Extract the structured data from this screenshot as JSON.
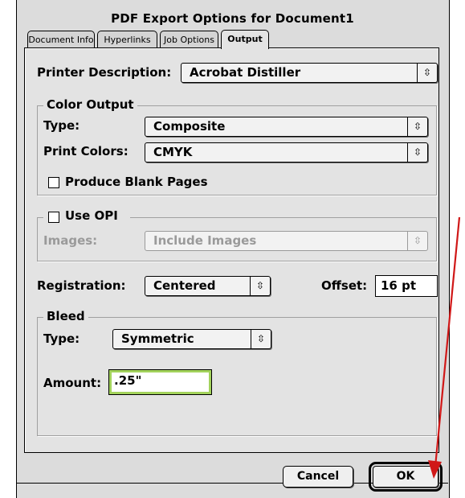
{
  "dialog": {
    "title": "PDF Export Options for Document1"
  },
  "tabs": [
    {
      "label": "Document Info"
    },
    {
      "label": "Hyperlinks"
    },
    {
      "label": "Job Options"
    },
    {
      "label": "Output"
    }
  ],
  "printer": {
    "label": "Printer Description:",
    "value": "Acrobat Distiller"
  },
  "color_output": {
    "title": "Color Output",
    "type_label": "Type:",
    "type_value": "Composite",
    "colors_label": "Print Colors:",
    "colors_value": "CMYK",
    "blank_pages_label": "Produce Blank Pages"
  },
  "opi": {
    "label": "Use OPI",
    "images_label": "Images:",
    "images_value": "Include Images"
  },
  "registration": {
    "label": "Registration:",
    "value": "Centered",
    "offset_label": "Offset:",
    "offset_value": "16 pt"
  },
  "bleed": {
    "title": "Bleed",
    "type_label": "Type:",
    "type_value": "Symmetric",
    "amount_label": "Amount:",
    "amount_value": ".25\""
  },
  "buttons": {
    "cancel": "Cancel",
    "ok": "OK"
  },
  "icons": {
    "popup_arrow": "updown-arrows-icon",
    "annotation": "red-arrow-icon"
  },
  "colors": {
    "focus_ring": "#a3d35c",
    "annotation_arrow": "#d01818"
  }
}
